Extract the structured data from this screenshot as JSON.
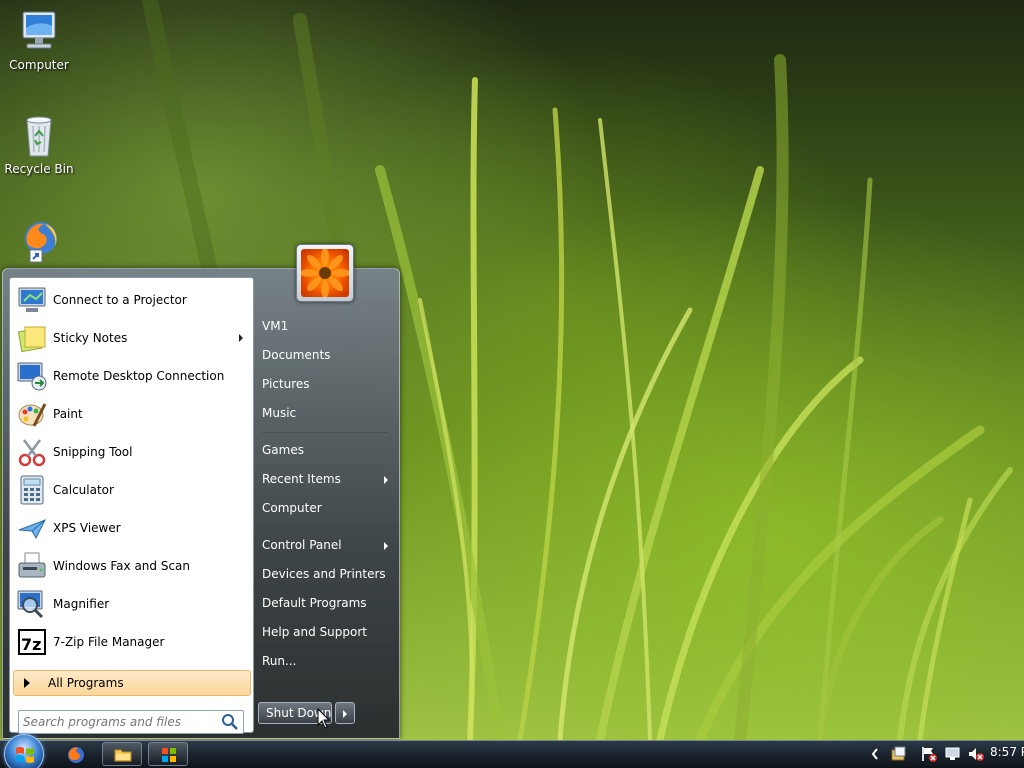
{
  "desktop": {
    "icons": [
      {
        "label": "Computer",
        "icon": "computer-icon"
      },
      {
        "label": "Recycle Bin",
        "icon": "recycle-bin-icon"
      },
      {
        "label": "",
        "icon": "firefox-shortcut-icon"
      }
    ]
  },
  "start_menu": {
    "programs": [
      {
        "label": "Connect to a Projector",
        "icon": "projector-icon",
        "submenu": false
      },
      {
        "label": "Sticky Notes",
        "icon": "sticky-notes-icon",
        "submenu": true
      },
      {
        "label": "Remote Desktop Connection",
        "icon": "remote-desktop-icon",
        "submenu": false
      },
      {
        "label": "Paint",
        "icon": "paint-icon",
        "submenu": false
      },
      {
        "label": "Snipping Tool",
        "icon": "snipping-tool-icon",
        "submenu": false
      },
      {
        "label": "Calculator",
        "icon": "calculator-icon",
        "submenu": false
      },
      {
        "label": "XPS Viewer",
        "icon": "xps-viewer-icon",
        "submenu": false
      },
      {
        "label": "Windows Fax and Scan",
        "icon": "fax-scan-icon",
        "submenu": false
      },
      {
        "label": "Magnifier",
        "icon": "magnifier-icon",
        "submenu": false
      },
      {
        "label": "7-Zip File Manager",
        "icon": "7zip-icon",
        "submenu": false
      }
    ],
    "all_programs": "All Programs",
    "search_placeholder": "Search programs and files",
    "right_links": [
      {
        "label": "VM1",
        "submenu": false
      },
      {
        "label": "Documents",
        "submenu": false
      },
      {
        "label": "Pictures",
        "submenu": false
      },
      {
        "label": "Music",
        "submenu": false
      },
      {
        "label": "Games",
        "submenu": false
      },
      {
        "label": "Recent Items",
        "submenu": true
      },
      {
        "label": "Computer",
        "submenu": false
      },
      {
        "label": "Control Panel",
        "submenu": true
      },
      {
        "label": "Devices and Printers",
        "submenu": false
      },
      {
        "label": "Default Programs",
        "submenu": false
      },
      {
        "label": "Help and Support",
        "submenu": false
      },
      {
        "label": "Run...",
        "submenu": false
      }
    ],
    "shutdown_label": "Shut Down"
  },
  "taskbar": {
    "pinned": [
      "firefox-icon",
      "explorer-folder-icon",
      "media-player-icon"
    ],
    "tray_icons": [
      "show-hidden-icons-icon",
      "action-center-icon",
      "flag-error-icon",
      "network-icon",
      "volume-muted-icon"
    ],
    "clock": "8:57 P"
  }
}
